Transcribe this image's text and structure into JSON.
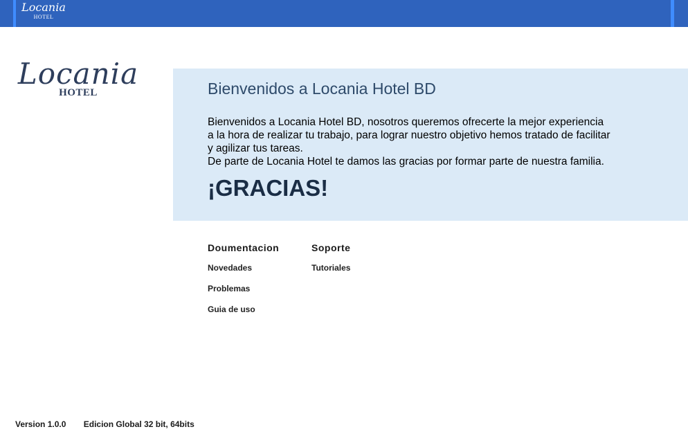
{
  "topbar": {
    "logo_script": "Locania",
    "logo_sub": "HOTEL"
  },
  "sidebar": {
    "logo_script": "Locania",
    "logo_sub": "HOTEL"
  },
  "welcome": {
    "title": "Bienvenidos a Locania Hotel BD",
    "lines": [
      "Bienvenidos a Locania Hotel BD, nosotros queremos ofrecerte la mejor experiencia",
      "a la hora de realizar tu trabajo, para lograr nuestro objetivo hemos tratado de facilitar",
      "y agilizar tus tareas.",
      "De parte de Locania Hotel te damos las gracias por formar parte de nuestra familia."
    ],
    "thanks": "¡GRACIAS!"
  },
  "links": {
    "documentation": {
      "heading": "Doumentacion",
      "items": [
        "Novedades",
        "Problemas",
        "Guia de uso"
      ]
    },
    "support": {
      "heading": "Soporte",
      "items": [
        "Tutoriales"
      ]
    }
  },
  "footer": {
    "version": "Version 1.0.0",
    "edition": "Edicion Global 32 bit, 64bits"
  },
  "colors": {
    "topbar": "#2f63bd",
    "topbar_edge": "#3f8cff",
    "panel": "#dbeaf7",
    "logo_text": "#2e3e5c"
  }
}
